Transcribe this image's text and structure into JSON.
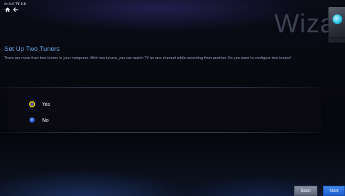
{
  "app": {
    "brand_prefix": "ArcSoft",
    "brand_name": "TV 5.0"
  },
  "header": {
    "wizard_title": "Wiza"
  },
  "page": {
    "title": "Set Up Two Tuners",
    "description": "There are more than two tuners in your computer. With two tuners, you can watch TV on one channel while recording from another. Do you want to configure two tuners?"
  },
  "options": [
    {
      "label": "Yes",
      "selected": true
    },
    {
      "label": "No",
      "selected": false
    }
  ],
  "buttons": {
    "back": "Back",
    "next": "Next"
  },
  "colors": {
    "accent": "#6ba9e6",
    "next_button": "#2a6fdc",
    "radio_ring": "#f0c419"
  },
  "icons": {
    "home": "home-icon",
    "back": "back-arrow-icon"
  }
}
